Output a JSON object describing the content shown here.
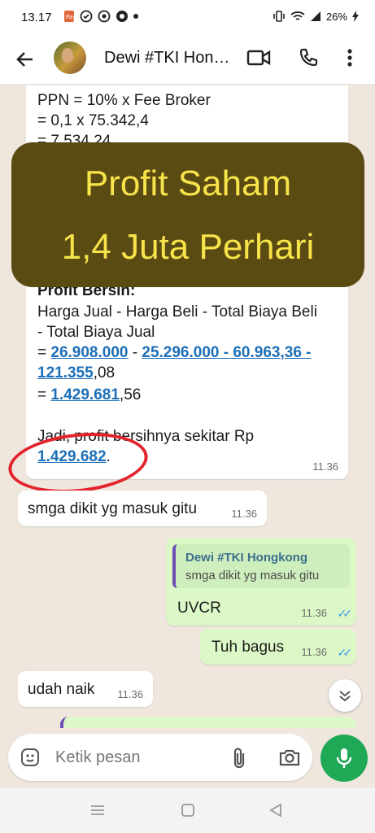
{
  "status_bar": {
    "time": "13.17",
    "battery": "26%"
  },
  "header": {
    "contact_name": "Dewi #TKI Hongkong"
  },
  "long_message": {
    "ppn_line": "PPN = 10% x Fee Broker",
    "ppn_calc": "= 0,1 x 75.342,4",
    "ppn_result": "= 7.534,24",
    "profit_heading": "Profit Bersih:",
    "formula_line1": "Harga Jual - Harga Beli - Total Biaya Beli",
    "formula_line2": "- Total Biaya Jual",
    "calc_eq": "=",
    "calc_v1": "26.908.000",
    "calc_sep1": "-",
    "calc_v2": "25.296.000 - 60.963",
    "calc_v3": ",36 -",
    "calc_v4": "121.355",
    "calc_v4_tail": ",08",
    "result_eq": "=",
    "result_v": "1.429.681",
    "result_tail": ",56",
    "conclusion": "Jadi, profit bersihnya sekitar Rp",
    "conclusion_v": "1.429.682",
    "conclusion_tail": ".",
    "time": "11.36"
  },
  "overlay": {
    "line1": "Profit Saham",
    "line2": "1,4 Juta Perhari"
  },
  "messages": [
    {
      "text": "smga dikit yg masuk gitu",
      "time": "11.36"
    },
    {
      "quote_name": "Dewi #TKI Hongkong",
      "quote_text": "smga dikit yg masuk gitu",
      "text": "UVCR",
      "time": "11.36"
    },
    {
      "text": "Tuh bagus",
      "time": "11.36"
    },
    {
      "text": "udah naik",
      "time": "11.36"
    }
  ],
  "input": {
    "placeholder": "Ketik pesan"
  },
  "colors": {
    "accent_green": "#1fa855",
    "link_blue": "#1d6fb8",
    "overlay_bg": "#5a4b13",
    "overlay_text": "#f7e34a",
    "circle_red": "#e3232b"
  }
}
